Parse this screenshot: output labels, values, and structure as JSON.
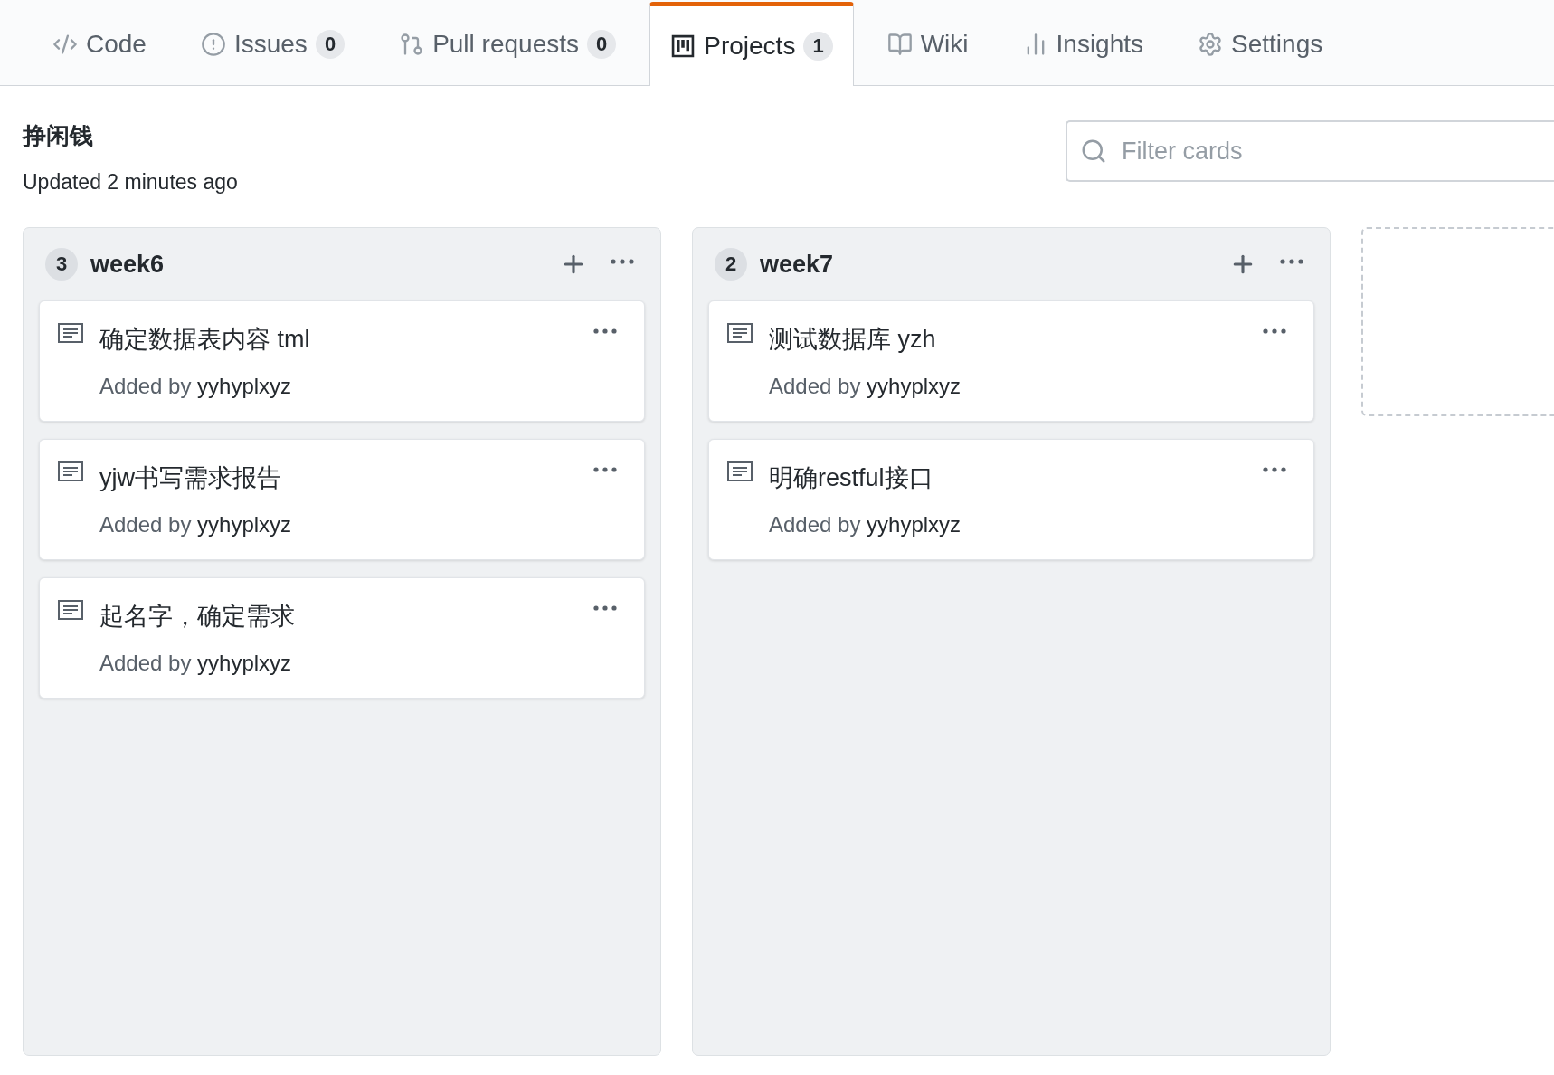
{
  "tabs": [
    {
      "label": "Code",
      "kind": "code",
      "selected": false
    },
    {
      "label": "Issues",
      "kind": "issues",
      "count": "0",
      "selected": false
    },
    {
      "label": "Pull requests",
      "kind": "pulls",
      "count": "0",
      "selected": false
    },
    {
      "label": "Projects",
      "kind": "projects",
      "count": "1",
      "selected": true
    },
    {
      "label": "Wiki",
      "kind": "wiki",
      "selected": false
    },
    {
      "label": "Insights",
      "kind": "insights",
      "selected": false
    },
    {
      "label": "Settings",
      "kind": "settings",
      "selected": false
    }
  ],
  "project": {
    "title": "挣闲钱",
    "updated": "Updated 2 minutes ago"
  },
  "filter": {
    "placeholder": "Filter cards"
  },
  "columns": [
    {
      "count": "3",
      "title": "week6",
      "cards": [
        {
          "title": "确定数据表内容 tml",
          "added_by": "Added by",
          "author": "yyhyplxyz"
        },
        {
          "title": "yjw书写需求报告",
          "added_by": "Added by",
          "author": "yyhyplxyz"
        },
        {
          "title": "起名字，确定需求",
          "added_by": "Added by",
          "author": "yyhyplxyz"
        }
      ]
    },
    {
      "count": "2",
      "title": "week7",
      "cards": [
        {
          "title": "测试数据库 yzh",
          "added_by": "Added by",
          "author": "yyhyplxyz"
        },
        {
          "title": "明确restful接口",
          "added_by": "Added by",
          "author": "yyhyplxyz"
        }
      ]
    }
  ],
  "add_column_placeholder": true
}
